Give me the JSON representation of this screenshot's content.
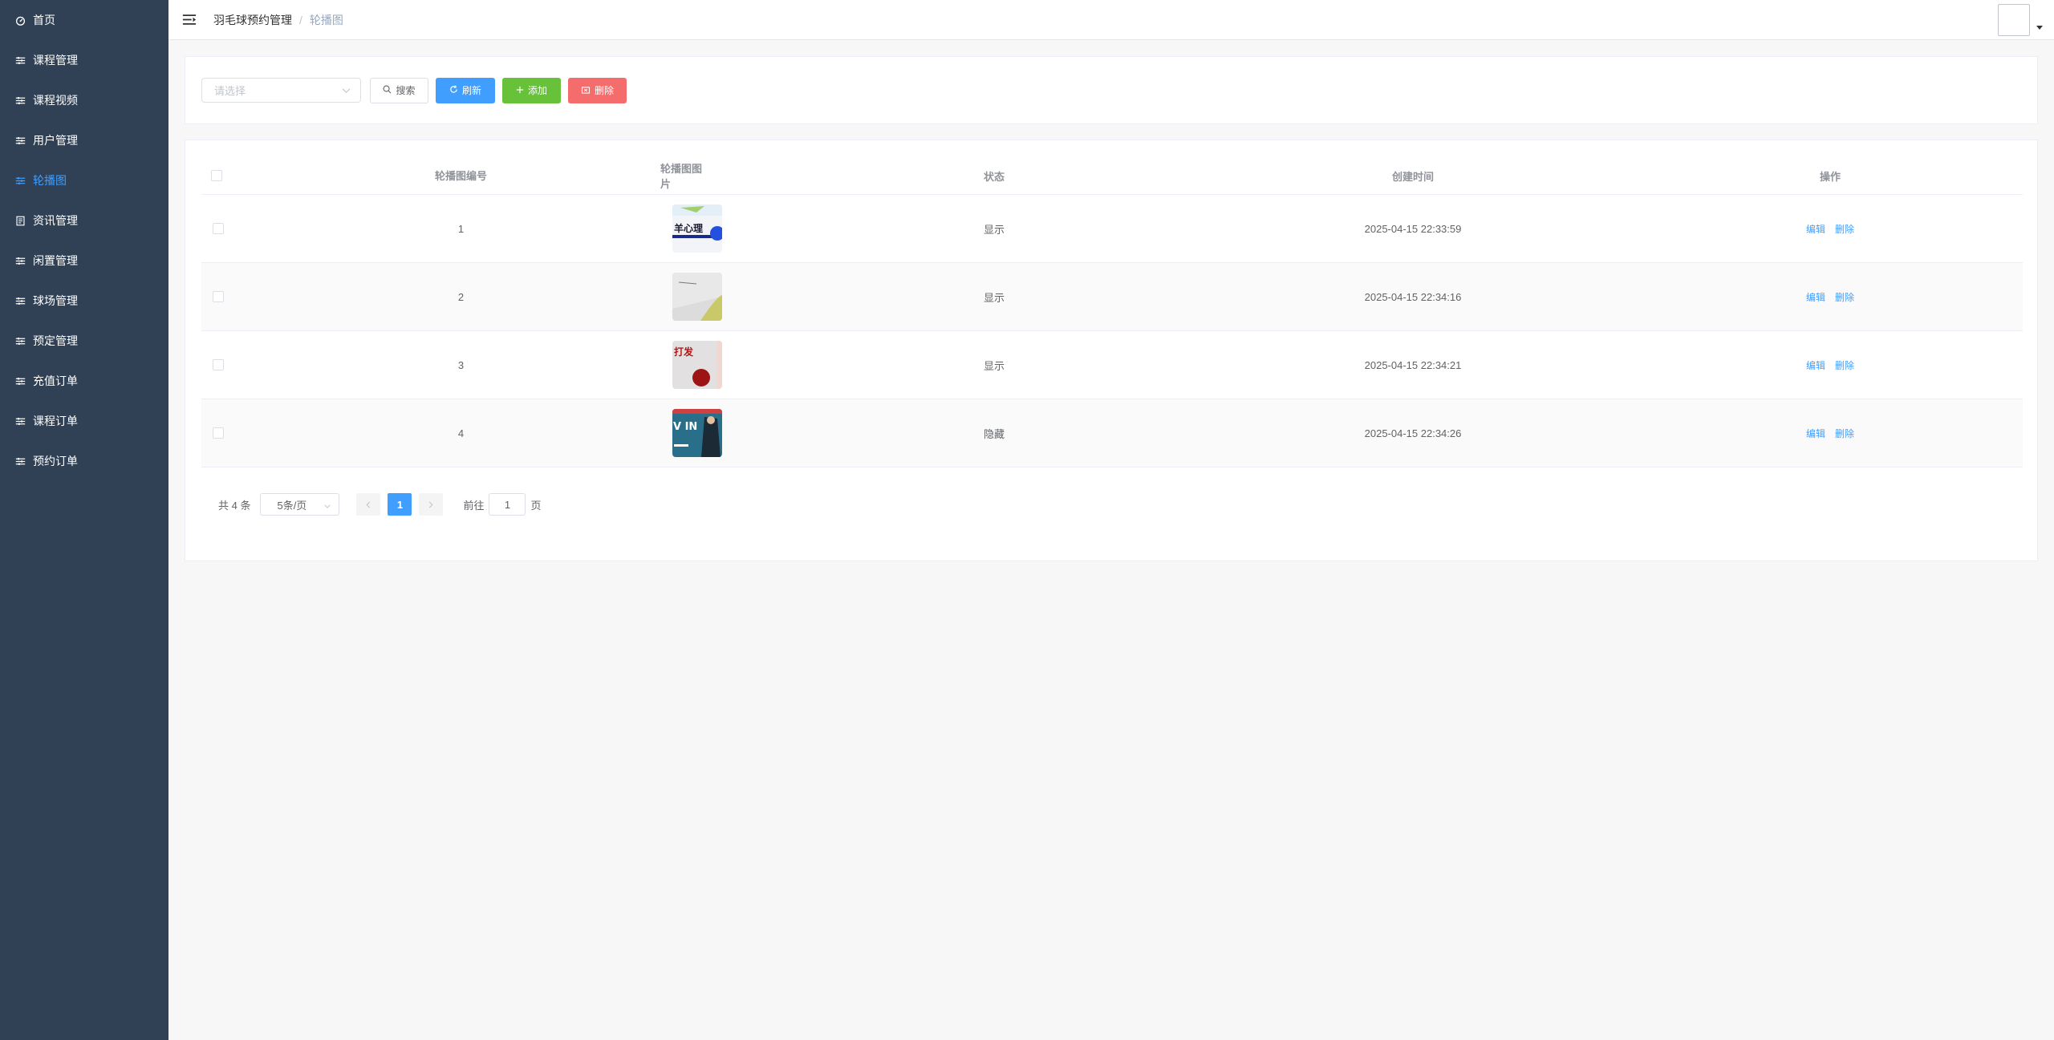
{
  "sidebar": {
    "items": [
      {
        "label": "首页",
        "icon": "dashboard-icon",
        "active": false
      },
      {
        "label": "课程管理",
        "icon": "sliders-icon",
        "active": false
      },
      {
        "label": "课程视频",
        "icon": "sliders-icon",
        "active": false
      },
      {
        "label": "用户管理",
        "icon": "sliders-icon",
        "active": false
      },
      {
        "label": "轮播图",
        "icon": "sliders-icon",
        "active": true
      },
      {
        "label": "资讯管理",
        "icon": "document-icon",
        "active": false
      },
      {
        "label": "闲置管理",
        "icon": "sliders-icon",
        "active": false
      },
      {
        "label": "球场管理",
        "icon": "sliders-icon",
        "active": false
      },
      {
        "label": "预定管理",
        "icon": "sliders-icon",
        "active": false
      },
      {
        "label": "充值订单",
        "icon": "sliders-icon",
        "active": false
      },
      {
        "label": "课程订单",
        "icon": "sliders-icon",
        "active": false
      },
      {
        "label": "预约订单",
        "icon": "sliders-icon",
        "active": false
      }
    ],
    "active_color": "#409eff",
    "bg_color": "#304156"
  },
  "header": {
    "breadcrumb": [
      "羽毛球预约管理",
      "轮播图"
    ],
    "breadcrumb_separator": "/"
  },
  "toolbar": {
    "select_placeholder": "请选择",
    "search_label": "搜索",
    "refresh_label": "刷新",
    "add_label": "添加",
    "delete_label": "删除"
  },
  "table": {
    "columns": [
      "轮播图编号",
      "轮播图图片",
      "状态",
      "创建时间",
      "操作"
    ],
    "rows": [
      {
        "id": "1",
        "status": "显示",
        "created": "2025-04-15 22:33:59",
        "edit": "编辑",
        "delete": "删除"
      },
      {
        "id": "2",
        "status": "显示",
        "created": "2025-04-15 22:34:16",
        "edit": "编辑",
        "delete": "删除"
      },
      {
        "id": "3",
        "status": "显示",
        "created": "2025-04-15 22:34:21",
        "edit": "编辑",
        "delete": "删除"
      },
      {
        "id": "4",
        "status": "隐藏",
        "created": "2025-04-15 22:34:26",
        "edit": "编辑",
        "delete": "删除"
      }
    ],
    "thumb_texts": [
      "羊心理",
      "",
      "打发",
      "V IN"
    ]
  },
  "pagination": {
    "total": "共 4 条",
    "page_size": "5条/页",
    "current_page": "1",
    "goto_prefix": "前往",
    "goto_value": "1",
    "goto_suffix": "页"
  },
  "colors": {
    "primary": "#409eff",
    "success": "#67c23a",
    "danger": "#f56c6c"
  }
}
